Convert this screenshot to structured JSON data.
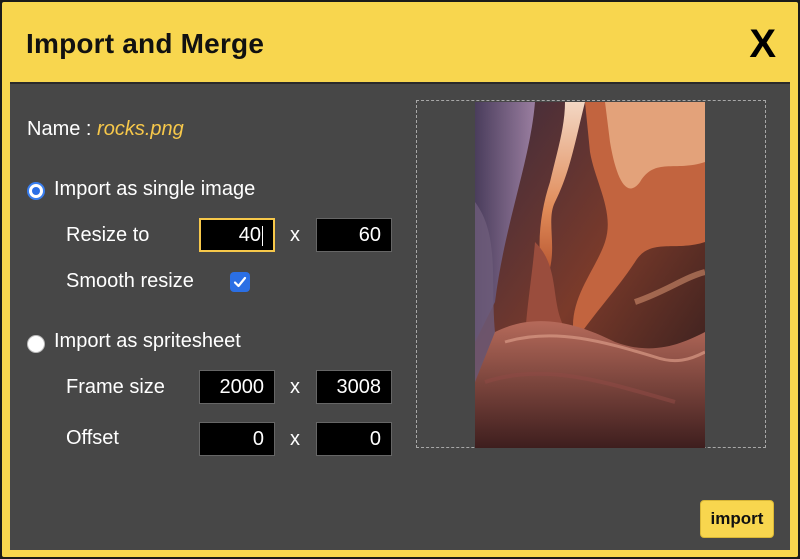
{
  "dialog": {
    "title": "Import and Merge",
    "close_label": "X"
  },
  "file": {
    "name_label": "Name : ",
    "name_value": "rocks.png"
  },
  "single_image": {
    "label": "Import as single image",
    "selected": true,
    "resize_label": "Resize to",
    "resize_width": "40",
    "resize_height": "60",
    "separator": "x",
    "smooth_label": "Smooth resize",
    "smooth_checked": true
  },
  "spritesheet": {
    "label": "Import as spritesheet",
    "selected": false,
    "frame_size_label": "Frame size",
    "frame_width": "2000",
    "frame_height": "3008",
    "offset_label": "Offset",
    "offset_x": "0",
    "offset_y": "0",
    "separator": "x"
  },
  "actions": {
    "import_label": "import"
  },
  "colors": {
    "accent_yellow": "#f8d64e",
    "panel_gray": "#474747",
    "name_highlight": "#f7c84a",
    "radio_blue": "#2c6fe6"
  }
}
